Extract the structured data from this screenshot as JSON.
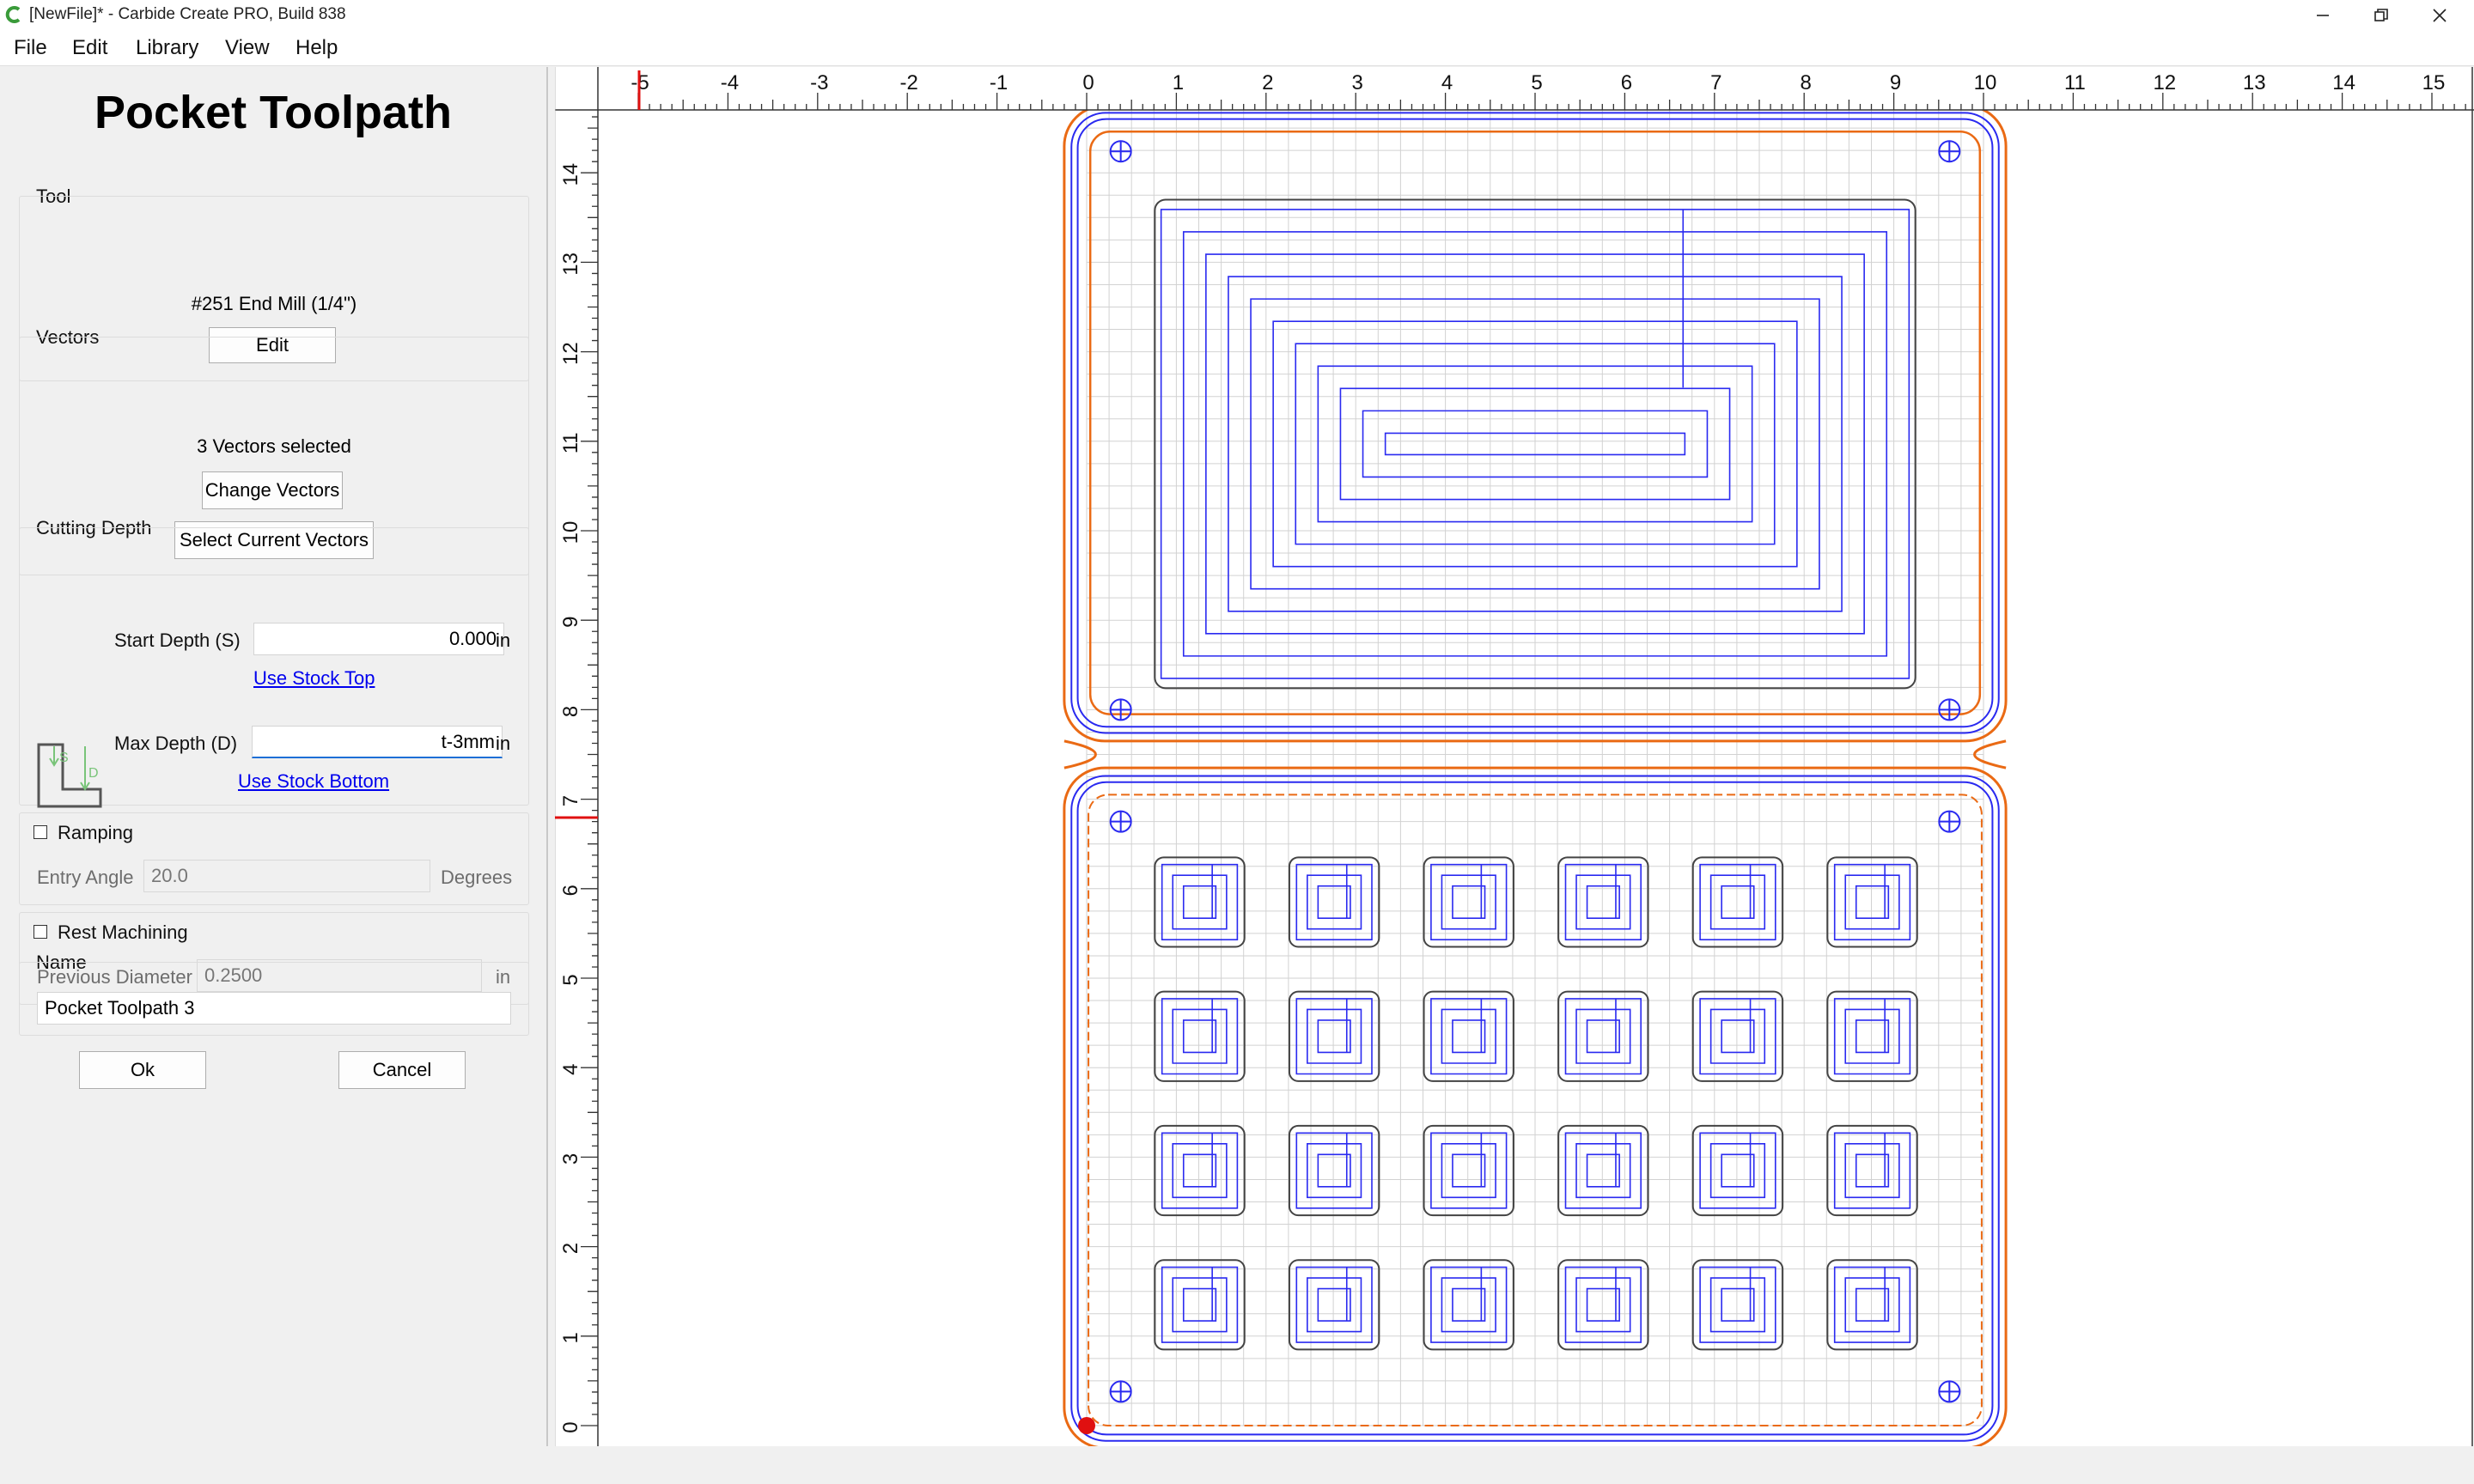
{
  "window": {
    "title": "[NewFile]* - Carbide Create PRO, Build 838",
    "minimize_icon": "minimize-icon",
    "maximize_icon": "restore-icon",
    "close_icon": "close-icon"
  },
  "menu": [
    "File",
    "Edit",
    "Library",
    "View",
    "Help"
  ],
  "panel": {
    "title": "Pocket Toolpath",
    "tool": {
      "heading": "Tool",
      "name": "#251 End Mill (1/4\")",
      "edit_label": "Edit"
    },
    "vectors": {
      "heading": "Vectors",
      "status": "3 Vectors selected",
      "change_label": "Change Vectors",
      "select_label": "Select Current Vectors"
    },
    "depth": {
      "heading": "Cutting Depth",
      "start_label": "Start Depth (S)",
      "start_value": "0.000",
      "start_unit": "in",
      "use_top": "Use Stock Top",
      "max_label": "Max Depth (D)",
      "max_value": "t-3mm",
      "max_unit": "in",
      "use_bottom": "Use Stock Bottom",
      "diagram_s": "S",
      "diagram_d": "D"
    },
    "ramping": {
      "label": "Ramping",
      "checked": false,
      "angle_label": "Entry Angle",
      "angle_value": "20.0",
      "angle_unit": "Degrees"
    },
    "rest": {
      "label": "Rest Machining",
      "checked": false,
      "diam_label": "Previous Diameter",
      "diam_value": "0.2500",
      "diam_unit": "in"
    },
    "name": {
      "heading": "Name",
      "value": "Pocket Toolpath 3"
    },
    "ok_label": "Ok",
    "cancel_label": "Cancel"
  },
  "canvas": {
    "x_ticks": [
      "-5",
      "-4",
      "-3",
      "-2",
      "-1",
      "0",
      "1",
      "2",
      "3",
      "4",
      "5",
      "6",
      "7",
      "8",
      "9",
      "10",
      "11",
      "12",
      "13",
      "14",
      "15"
    ],
    "y_ticks": [
      "0",
      "1",
      "2",
      "3",
      "4",
      "5",
      "6",
      "7",
      "8",
      "9",
      "10",
      "11",
      "12",
      "13",
      "14"
    ],
    "colors": {
      "toolpath": "#2a2af0",
      "outline": "#ea6a14",
      "vector": "#444444",
      "grid": "#d2d2d2",
      "marker": "#e01010"
    }
  }
}
